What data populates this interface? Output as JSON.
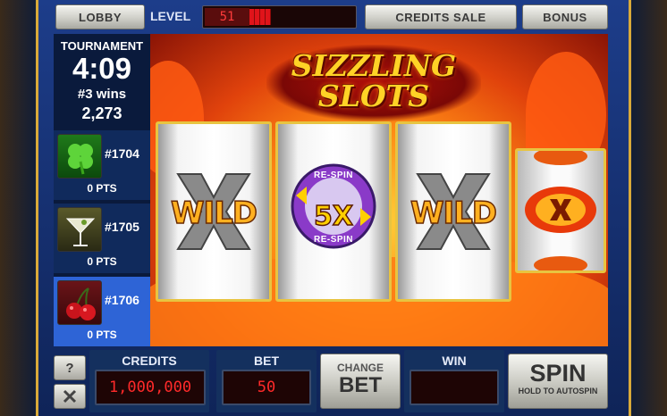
{
  "top_bar": {
    "lobby_label": "LOBBY",
    "level_label": "LEVEL",
    "level_value": "51",
    "level_progress": 0.15,
    "credits_sale_label": "CREDITS SALE",
    "bonus_label": "BONUS"
  },
  "tournament": {
    "title": "TOURNAMENT",
    "time_left": "4:09",
    "wins": "#3 wins",
    "score": "2,273",
    "entries": [
      {
        "rank": "#1704",
        "points": "0 PTS",
        "icon": "clover-icon"
      },
      {
        "rank": "#1705",
        "points": "0 PTS",
        "icon": "martini-icon"
      },
      {
        "rank": "#1706",
        "points": "0 PTS",
        "icon": "cherries-icon"
      }
    ]
  },
  "game": {
    "logo_line1": "SIZZLING",
    "logo_line2": "SLOTS",
    "reels": [
      {
        "symbol": "WILD"
      },
      {
        "symbol": "5X",
        "top_label": "RE-SPIN",
        "bottom_label": "RE-SPIN"
      },
      {
        "symbol": "WILD"
      }
    ],
    "bonus_reel_symbol": "x-icon"
  },
  "bottom_bar": {
    "help_label": "?",
    "credits_label": "CREDITS",
    "credits_value": "1,000,000",
    "bet_label": "BET",
    "bet_value": "50",
    "change_bet_line1": "CHANGE",
    "change_bet_line2": "BET",
    "win_label": "WIN",
    "win_value": "",
    "spin_label": "SPIN",
    "spin_sub": "HOLD TO AUTOSPIN"
  },
  "colors": {
    "accent_gold": "#e8c440",
    "led_red": "#ff2a2a",
    "panel_blue": "#0a1a3c",
    "active_entry": "#2e64d6"
  }
}
